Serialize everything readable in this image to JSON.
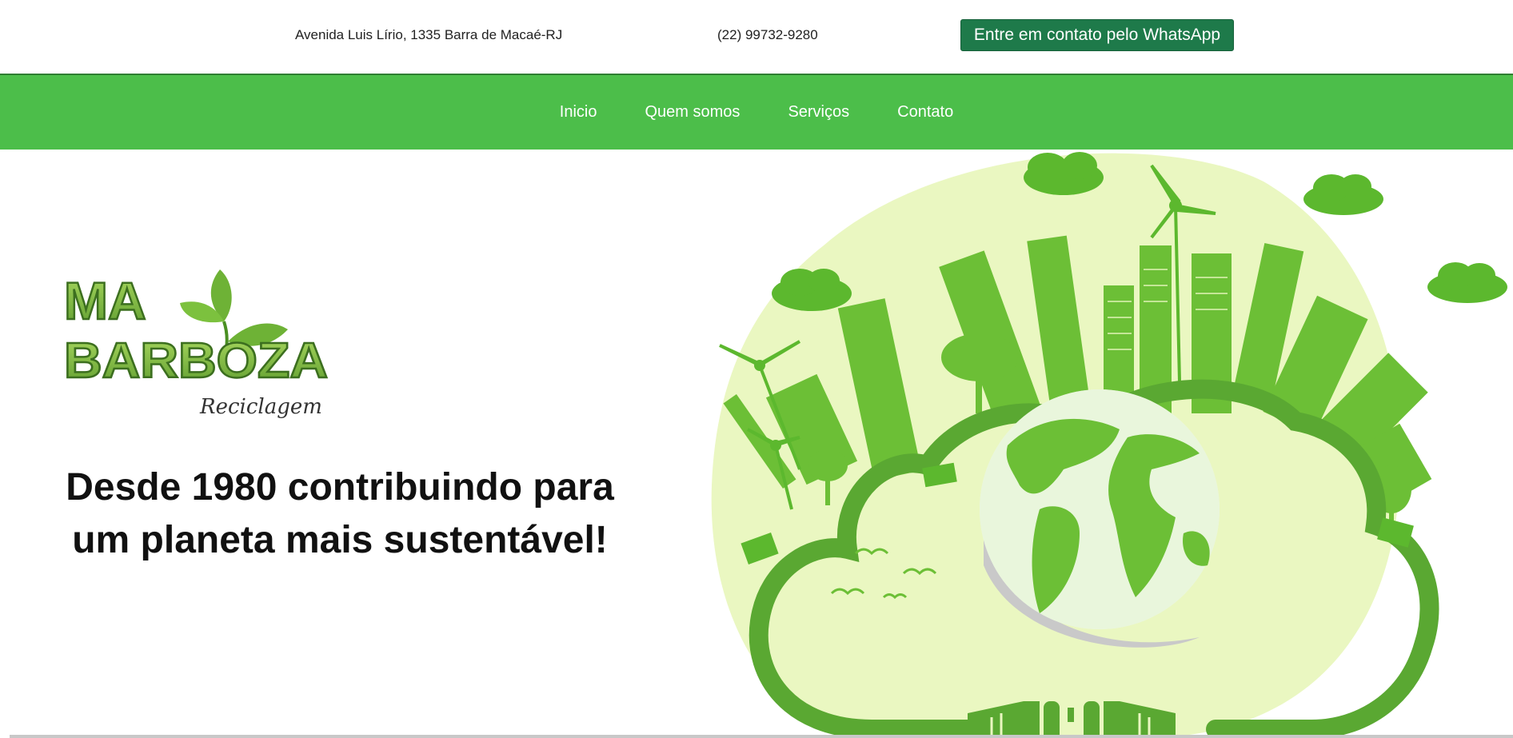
{
  "topbar": {
    "address": "Avenida Luis Lírio, 1335 Barra de Macaé-RJ",
    "phone": "(22) 99732-9280",
    "whatsapp_button": "Entre em contato pelo WhatsApp"
  },
  "nav": {
    "items": [
      {
        "label": "Inicio"
      },
      {
        "label": "Quem somos"
      },
      {
        "label": "Serviços"
      },
      {
        "label": "Contato"
      }
    ]
  },
  "hero": {
    "logo": {
      "line1": "MA",
      "line2": "BARBOZA",
      "tagline": "Reciclagem"
    },
    "headline_line1": "Desde 1980 contribuindo para",
    "headline_line2": "um planeta mais sustentável!",
    "illustration_icon": "eco-city-globe-icon"
  },
  "colors": {
    "nav_green": "#4cbe4a",
    "button_green": "#1e7a4a",
    "illustration_green": "#5cb82e",
    "illustration_bg": "#eaf7c1"
  }
}
